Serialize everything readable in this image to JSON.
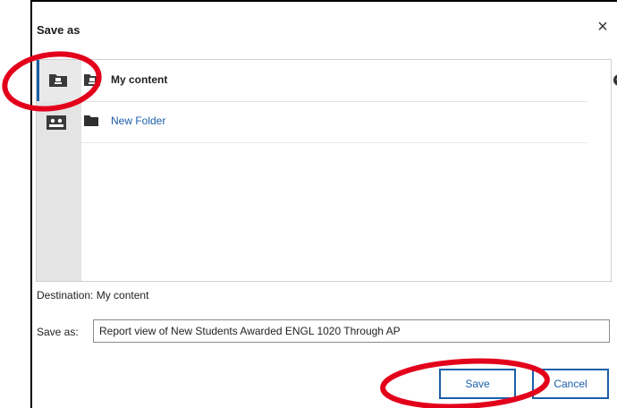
{
  "dialog": {
    "title": "Save as",
    "close_symbol": "×"
  },
  "sidebar": {
    "items": [
      {
        "icon": "my-content-folder-icon",
        "active": true
      },
      {
        "icon": "team-content-icon",
        "active": false
      }
    ]
  },
  "tree": {
    "header_label": "My content",
    "add_symbol": "+",
    "folders": [
      {
        "label": "New Folder",
        "icon": "folder-icon"
      }
    ]
  },
  "destination": {
    "label": "Destination:",
    "value": "My content"
  },
  "save_as": {
    "label": "Save as:",
    "value": "Report view of New Students Awarded ENGL 1020 Through AP"
  },
  "buttons": {
    "save": "Save",
    "cancel": "Cancel"
  },
  "colors": {
    "accent": "#1a5fa8",
    "annotation": "#e3001b"
  }
}
